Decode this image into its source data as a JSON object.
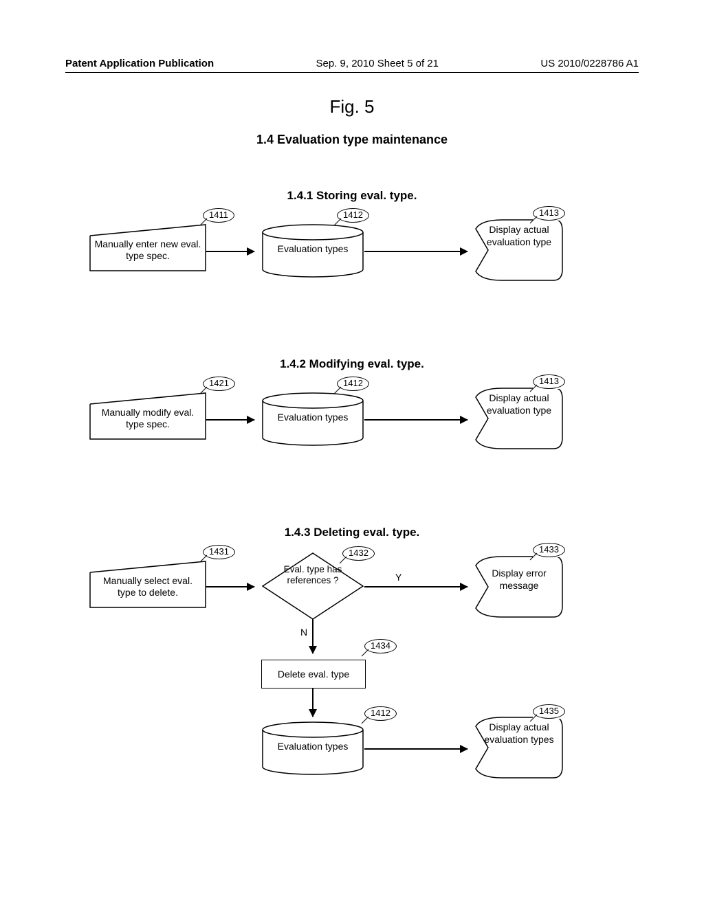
{
  "header": {
    "left": "Patent Application Publication",
    "mid": "Sep. 9, 2010  Sheet 5 of 21",
    "right": "US 2010/0228786 A1"
  },
  "figure_label": "Fig. 5",
  "title": "1.4 Evaluation type maintenance",
  "section1": {
    "subtitle": "1.4.1 Storing eval. type.",
    "input": "Manually enter new eval. type spec.",
    "input_ref": "1411",
    "db": "Evaluation types",
    "db_ref": "1412",
    "display": "Display actual evaluation type",
    "display_ref": "1413"
  },
  "section2": {
    "subtitle": "1.4.2 Modifying eval. type.",
    "input": "Manually modify eval. type spec.",
    "input_ref": "1421",
    "db": "Evaluation types",
    "db_ref": "1412",
    "display": "Display actual evaluation type",
    "display_ref": "1413"
  },
  "section3": {
    "subtitle": "1.4.3 Deleting eval. type.",
    "input": "Manually select eval. type to delete.",
    "input_ref": "1431",
    "decision": "Eval. type has references ?",
    "decision_ref": "1432",
    "decision_yes": "Y",
    "decision_no": "N",
    "display_err": "Display error message",
    "display_err_ref": "1433",
    "process": "Delete eval. type",
    "process_ref": "1434",
    "db": "Evaluation types",
    "db_ref": "1412",
    "display_ok": "Display actual evaluation types",
    "display_ok_ref": "1435"
  }
}
